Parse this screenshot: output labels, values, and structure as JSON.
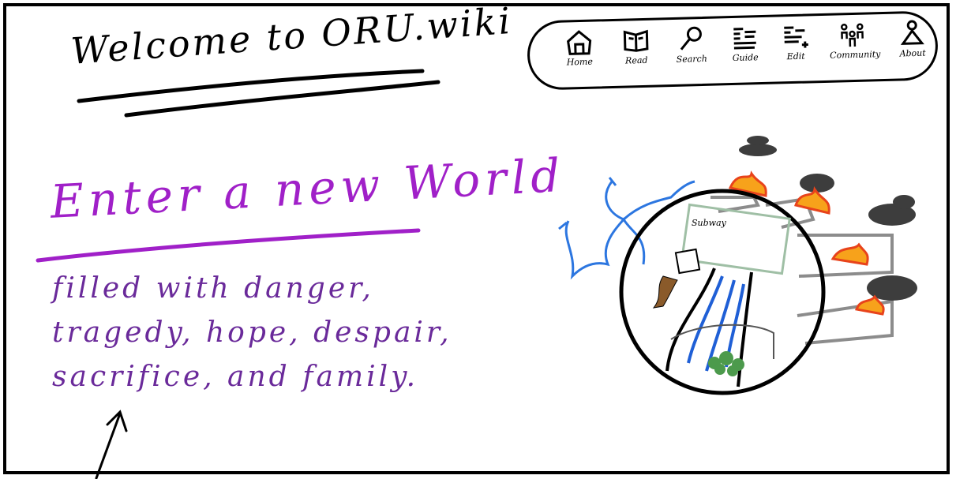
{
  "page": {
    "title": "Welcome to ORU.wiki"
  },
  "nav": {
    "items": [
      {
        "label": "Home",
        "icon": "home-icon"
      },
      {
        "label": "Read",
        "icon": "book-icon"
      },
      {
        "label": "Search",
        "icon": "search-icon"
      },
      {
        "label": "Guide",
        "icon": "guide-icon"
      },
      {
        "label": "Edit",
        "icon": "edit-icon"
      },
      {
        "label": "Community",
        "icon": "community-icon"
      },
      {
        "label": "About",
        "icon": "about-icon"
      }
    ]
  },
  "hero": {
    "heading": "Enter a new World",
    "lines": [
      "filled with danger,",
      "tragedy, hope, despair,",
      "sacrifice, and family."
    ]
  },
  "illustration": {
    "subway_label": "Subway"
  },
  "colors": {
    "ink": "#000000",
    "heading": "#a020c8",
    "body_text": "#6a2a9a",
    "river": "#1f5fd6",
    "fire": "#f26a1b",
    "smoke": "#3a3a3a"
  }
}
